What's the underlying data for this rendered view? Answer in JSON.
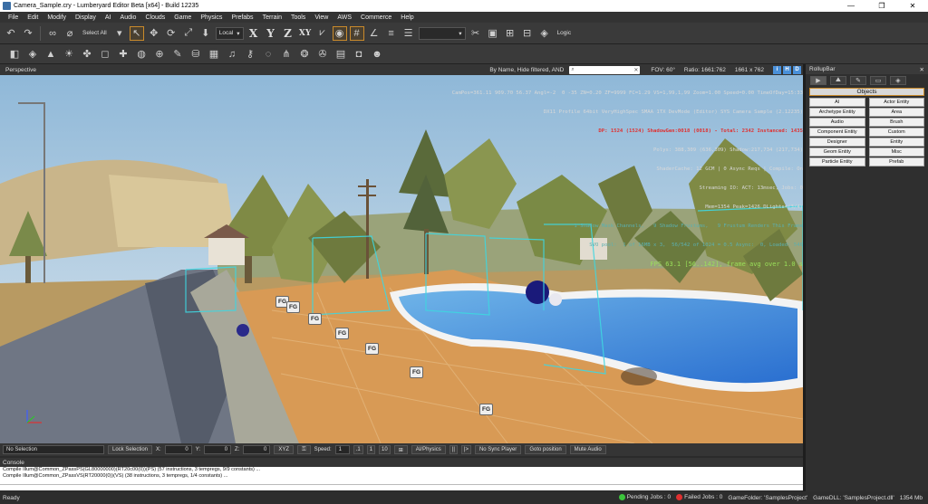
{
  "window": {
    "title": "Camera_Sample.cry - Lumberyard Editor Beta [x64] - Build 12235",
    "minimize": "—",
    "maximize": "❐",
    "close": "✕"
  },
  "menu": [
    "File",
    "Edit",
    "Modify",
    "Display",
    "AI",
    "Audio",
    "Clouds",
    "Game",
    "Physics",
    "Prefabs",
    "Terrain",
    "Tools",
    "View",
    "AWS",
    "Commerce",
    "Help"
  ],
  "toolbar": {
    "select_all": "Select All",
    "ref_coord": "Local",
    "axis_x": "X",
    "axis_y": "Y",
    "axis_z": "Z",
    "axis_xy": "XY",
    "logic": "Logic"
  },
  "viewport": {
    "title": "Perspective",
    "filter": "By Name, Hide filtered, AND",
    "fov": "FOV:   60°",
    "ratio": "Ratio:  1661:762",
    "size": "1661 x 762",
    "btn_i": "i",
    "btn_h": "H",
    "btn_d": "D"
  },
  "stats": {
    "line1": "CamPos=361.11 909.70 56.37 Angl=-2  0 -35 ZN=0.20 ZF=9999 FC=1.29 VS=1,99,1,99 Zoom=1.00 Speed=0.00 TimeOfDay=15:33",
    "line2": "DX11 Profile 64bit VeryHighSpec SMAA 1TX DevMode (Editor) SYS Camera Sample (2.12235)",
    "line3": "DP: 1524 (1524) ShadowGen:0018 (0018) - Total: 2342 Instanced: 1435",
    "line4": "Polys: 388,309 (636,309) Shadow:217,734 (217,734)",
    "line5": "ShaderCache: 12 GCM | 0 Async Reqs | Compile: On",
    "line6": "Streaming IO: ACT: 13msec, Jobs: 0",
    "line7": "Mem=1354 Peak=1426 DLights=(3/4)",
    "line8": "1 Shadow Mask Channels,   9 Shadow Frustums,   9 Frustum Renders This Frame",
    "line9": "SVO pool:  1 of 16MB x 3,  56/542 of 1024 = 0.5 Async:  0, Loaded: 546",
    "line10": "FPS 63.1 [56..142], frame avg over 1.0 s"
  },
  "fg_label": "FG",
  "bottombar": {
    "selection": "No Selection",
    "lock": "Lock Selection",
    "x_label": "X:",
    "x_val": "0",
    "y_label": "Y:",
    "y_val": "0",
    "z_label": "Z:",
    "z_val": "0",
    "xyz": "XYZ",
    "speed_label": "Speed:",
    "speed_val": "1",
    "speed_a": ".1",
    "speed_b": "1",
    "speed_c": "10",
    "ai_physics": "AI/Physics",
    "pause": "||",
    "step": "|>",
    "sync": "No Sync Player",
    "goto": "Goto position",
    "mute": "Mute Audio"
  },
  "console": {
    "title": "Console",
    "line1": "Compile Illum@Common_ZPassPS(GL80000000)(RT20c00(0))(PS) (57 instructions, 3 tempregs, 9/9 constants) ...",
    "line2": "Compile Illum@Common_ZPassVS(RT20000(0))(VS) (38 instructions, 3 tempregs, 1/4 constants) ..."
  },
  "status": {
    "ready": "Ready",
    "pending": "Pending Jobs : 0",
    "failed": "Failed Jobs : 0",
    "game_folder": "GameFolder: 'SamplesProject'",
    "game_dll": "GameDLL: 'SamplesProject.dll'",
    "mem": "1354 Mb"
  },
  "rollup": {
    "title": "RollupBar",
    "objects": "Objects",
    "buttons": [
      "AI",
      "Actor Entity",
      "Archetype Entity",
      "Area",
      "Audio",
      "Brush",
      "Component Entity",
      "Custom",
      "Designer",
      "Entity",
      "Geom Entity",
      "Misc",
      "Particle Entity",
      "Prefab"
    ]
  },
  "colors": {
    "accent": "#c98a2b",
    "fps_green": "#9ae05a",
    "dp_red": "#e03030",
    "volume_cyan": "#3fd6e0"
  }
}
